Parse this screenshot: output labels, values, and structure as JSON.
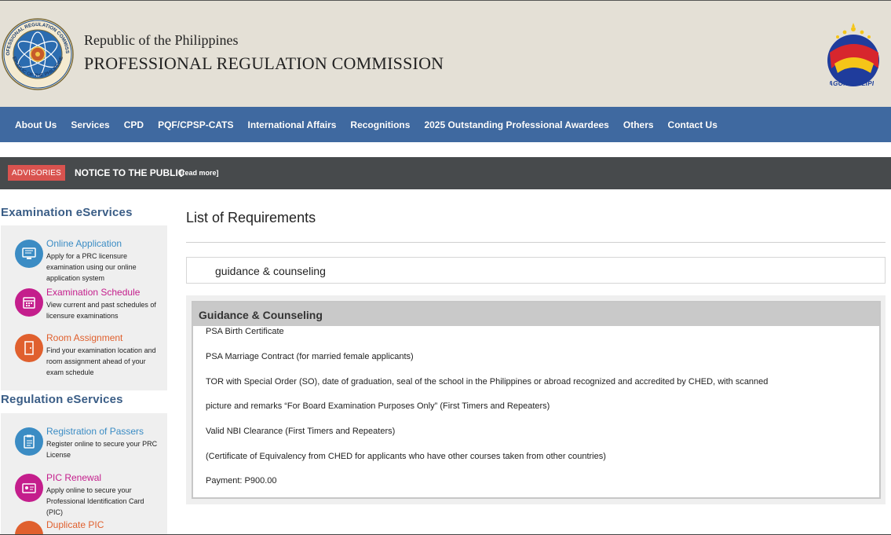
{
  "header": {
    "line1": "Republic of the Philippines",
    "line2": "PROFESSIONAL REGULATION COMMISSION",
    "seal_text_top": "PROFESSIONAL REGULATION COMMISSION",
    "seal_text_bottom": "REPUBLIC OF THE PHILIPPINES",
    "bp_text": "BAGONG PILIPINAS"
  },
  "nav": {
    "items": [
      "About Us",
      "Services",
      "CPD",
      "PQF/CPSP-CATS",
      "International Affairs",
      "Recognitions",
      "2025 Outstanding Professional Awardees",
      "Others",
      "Contact Us"
    ]
  },
  "notice": {
    "badge": "ADVISORIES",
    "title": "NOTICE TO THE PUBLIC",
    "read_more": "[read more]"
  },
  "sidebar": {
    "exam_title": "Examination eServices",
    "exam_items": [
      {
        "title": "Online Application",
        "desc": "Apply for a PRC licensure examination using our online application system",
        "icon": "monitor-icon"
      },
      {
        "title": "Examination Schedule",
        "desc": "View current and past schedules of licensure examinations",
        "icon": "calendar-icon"
      },
      {
        "title": "Room Assignment",
        "desc": "Find your examination location and room assignment ahead of your exam schedule",
        "icon": "door-icon"
      }
    ],
    "reg_title": "Regulation eServices",
    "reg_items": [
      {
        "title": "Registration of Passers",
        "desc": "Register online to secure your PRC License",
        "icon": "clipboard-icon"
      },
      {
        "title": "PIC Renewal",
        "desc": "Apply online to secure your Professional Identification Card (PIC)",
        "icon": "id-card-icon"
      },
      {
        "title": "Duplicate PIC",
        "desc": "",
        "icon": "id-card-copy-icon"
      }
    ]
  },
  "main": {
    "title": "List of Requirements",
    "search_value": "guidance & counseling",
    "result_title": "Guidance & Counseling",
    "requirements": [
      "PSA Birth Certificate",
      "PSA Marriage Contract (for married female applicants)",
      "TOR with Special Order (SO), date of graduation, seal of the school in the Philippines or abroad recognized and accredited by CHED, with scanned",
      "picture and remarks “For Board Examination Purposes Only” (First Timers and Repeaters)",
      "Valid NBI Clearance (First Timers and Repeaters)",
      "(Certificate of Equivalency from CHED for applicants who have other courses taken from other countries)",
      "Payment: P900.00"
    ]
  },
  "colors": {
    "header_bg": "#e4e0d6",
    "nav_bg": "#3f69a0",
    "notice_bg": "#474a4c",
    "badge": "#d9534f",
    "sidebar_title": "#3a5d86",
    "blue_item": "#3b8cc4",
    "magenta_item": "#c41e8c",
    "orange_item": "#e0602e"
  }
}
